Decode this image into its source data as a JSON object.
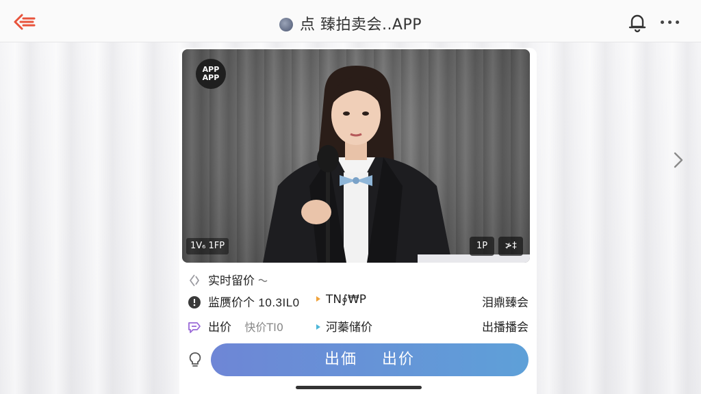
{
  "header": {
    "title": "点 臻拍卖会..APP",
    "back_icon": "back-arrow-icon",
    "bell_icon": "bell-icon",
    "more_icon": "more-dots-icon"
  },
  "video": {
    "logo_line1": "APP",
    "logo_line2": "APP",
    "tag": "1V₆ 1FP",
    "ctrl_left": "1P",
    "ctrl_right": "≯‡"
  },
  "info": {
    "realtime_label": "实时留价",
    "row1_label": "监赝价个",
    "row1_value": "10.3IL0",
    "row1_mid": "TN∮₩P",
    "row1_right": "泪鼑臻会",
    "row2_label": "出价",
    "row2_muted": "快价TI0",
    "row2_mid": "河蓁储价",
    "row2_right": "出播播会"
  },
  "action": {
    "bid_left": "出価",
    "bid_right": "出价"
  },
  "colors": {
    "accent": "#e8533b",
    "button_start": "#6e86d6",
    "button_end": "#5ea0d8",
    "purple": "#9a6ad8"
  }
}
